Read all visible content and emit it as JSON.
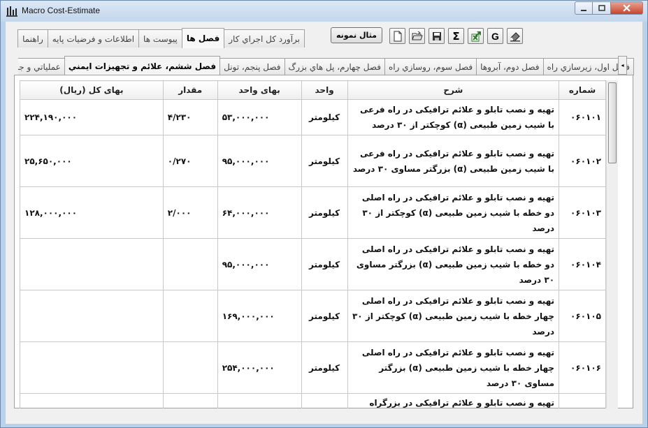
{
  "window": {
    "title": "Macro Cost-Estimate"
  },
  "top_tabs": [
    {
      "label": "راهنما",
      "active": false
    },
    {
      "label": "اطلاعات و فرضيات پايه",
      "active": false
    },
    {
      "label": "پيوست ها",
      "active": false
    },
    {
      "label": "فصل ها",
      "active": true
    },
    {
      "label": "برآورد کل اجراي کار",
      "active": false
    }
  ],
  "toolbar": {
    "sample_label": "مثال نمونه",
    "buttons": [
      {
        "name": "new-file-icon"
      },
      {
        "name": "open-folder-icon"
      },
      {
        "name": "save-disk-icon"
      },
      {
        "name": "sigma-icon",
        "glyph": "Σ"
      },
      {
        "name": "excel-icon"
      },
      {
        "name": "g-icon",
        "glyph": "G"
      },
      {
        "name": "eraser-icon"
      }
    ]
  },
  "section_tabs": [
    {
      "label": "عملياتي و جنبي",
      "active": false
    },
    {
      "label": "فصل ششم، علائم و تجهيزات ايمني",
      "active": true
    },
    {
      "label": "فصل پنجم، تونل",
      "active": false
    },
    {
      "label": "فصل چهارم، پل هاي بزرگ",
      "active": false
    },
    {
      "label": "فصل سوم، روسازي راه",
      "active": false
    },
    {
      "label": "فصل دوم، آبروها",
      "active": false
    },
    {
      "label": "فصل اول، زيرسازي راه",
      "active": false
    }
  ],
  "table": {
    "headers": {
      "code": "شماره",
      "desc": "شرح",
      "unit": "واحد",
      "unit_price": "بهای واحد",
      "qty": "مقدار",
      "total": "بهای کل (ریال)"
    },
    "rows": [
      {
        "code": "۰۶۰۱۰۱",
        "desc": "تهیه و نصب تابلو و علائم ترافیکی در راه فرعی با شیب زمین طبیعی (α) کوچکتر از ۳۰ درصد",
        "unit": "کیلومتر",
        "unit_price": "۵۳,۰۰۰,۰۰۰",
        "qty": "۴/۲۳۰",
        "total": "۲۲۴,۱۹۰,۰۰۰"
      },
      {
        "code": "۰۶۰۱۰۲",
        "desc": "تهیه و نصب تابلو و علائم ترافیکی در راه فرعی با شیب زمین طبیعی (α) بزرگتر مساوی ۳۰ درصد",
        "unit": "کیلومتر",
        "unit_price": "۹۵,۰۰۰,۰۰۰",
        "qty": "۰/۲۷۰",
        "total": "۲۵,۶۵۰,۰۰۰"
      },
      {
        "code": "۰۶۰۱۰۳",
        "desc": "تهیه و نصب تابلو و علائم ترافیکی در راه اصلی دو خطه با شیب زمین طبیعی (α) کوچکتر از ۳۰ درصد",
        "unit": "کیلومتر",
        "unit_price": "۶۴,۰۰۰,۰۰۰",
        "qty": "۲/۰۰۰",
        "total": "۱۲۸,۰۰۰,۰۰۰"
      },
      {
        "code": "۰۶۰۱۰۴",
        "desc": "تهیه و نصب تابلو و علائم ترافیکی در راه اصلی دو خطه با شیب زمین طبیعی (α) بزرگتر مساوی ۳۰ درصد",
        "unit": "کیلومتر",
        "unit_price": "۹۵,۰۰۰,۰۰۰",
        "qty": "",
        "total": ""
      },
      {
        "code": "۰۶۰۱۰۵",
        "desc": "تهیه و نصب تابلو و علائم ترافیکی در راه اصلی چهار خطه با شیب زمین طبیعی (α) کوچکتر از ۳۰ درصد",
        "unit": "کیلومتر",
        "unit_price": "۱۶۹,۰۰۰,۰۰۰",
        "qty": "",
        "total": ""
      },
      {
        "code": "۰۶۰۱۰۶",
        "desc": "تهیه و نصب تابلو و علائم ترافیکی در راه اصلی چهار خطه با شیب زمین طبیعی (α) بزرگتر مساوی ۳۰ درصد",
        "unit": "کیلومتر",
        "unit_price": "۲۵۴,۰۰۰,۰۰۰",
        "qty": "",
        "total": ""
      },
      {
        "code": "",
        "desc": "تهیه و نصب تابلو و علائم ترافیکی در بزرگراه",
        "unit": "",
        "unit_price": "",
        "qty": "",
        "total": ""
      }
    ]
  }
}
